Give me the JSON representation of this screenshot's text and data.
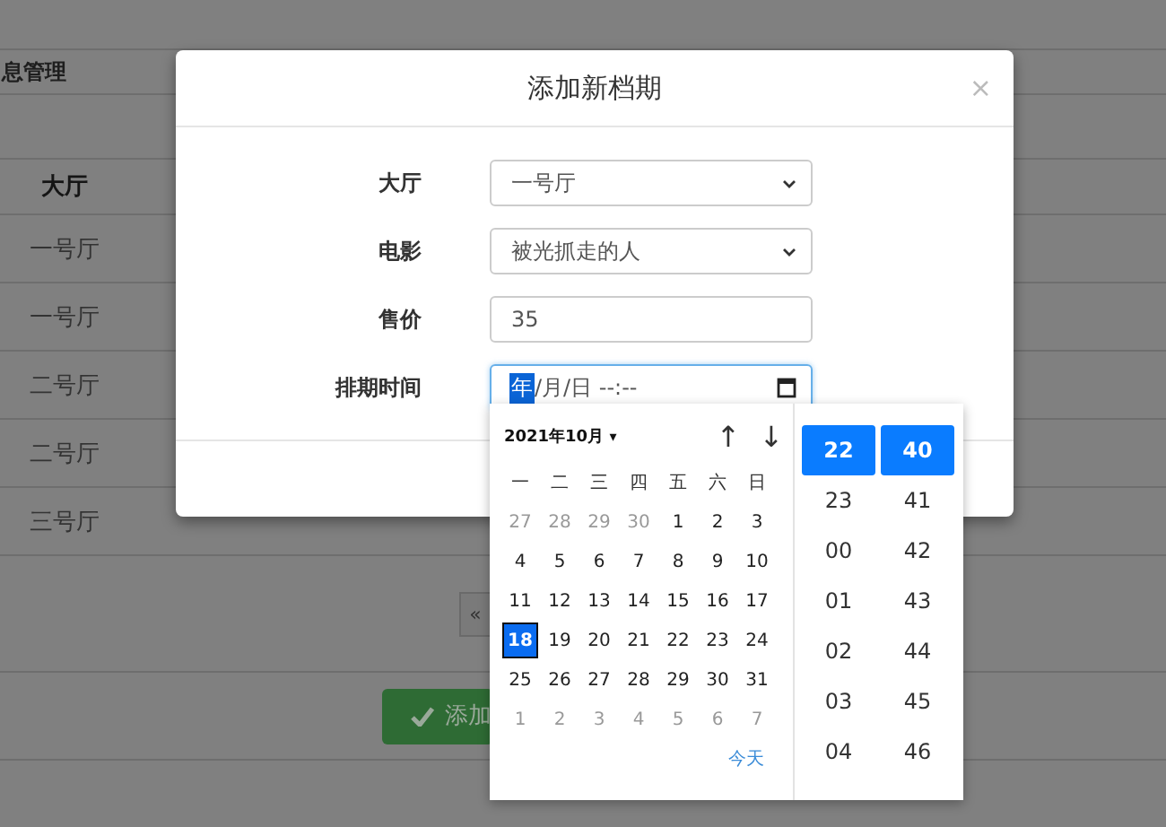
{
  "page": {
    "section_title": "息管理",
    "column_header": "大厅",
    "rows": [
      "一号厅",
      "一号厅",
      "二号厅",
      "二号厅",
      "三号厅"
    ],
    "pager": "«",
    "add_button": "添加"
  },
  "modal": {
    "title": "添加新档期",
    "close": "×",
    "fields": [
      {
        "kind": "select",
        "label": "大厅",
        "value": "一号厅"
      },
      {
        "kind": "select",
        "label": "电影",
        "value": "被光抓走的人"
      },
      {
        "kind": "input",
        "label": "售价",
        "value": "35"
      },
      {
        "kind": "datetime",
        "label": "排期时间",
        "value_parts": [
          "年",
          "/月/日 --:--"
        ]
      }
    ]
  },
  "picker": {
    "month": "2021年10月",
    "caret": "▾",
    "up": "↑",
    "down": "↓",
    "weekdays": [
      "一",
      "二",
      "三",
      "四",
      "五",
      "六",
      "日"
    ],
    "weeks": [
      [
        {
          "d": "27",
          "muted": true,
          "selected": false
        },
        {
          "d": "28",
          "muted": true,
          "selected": false
        },
        {
          "d": "29",
          "muted": true,
          "selected": false
        },
        {
          "d": "30",
          "muted": true,
          "selected": false
        },
        {
          "d": "1",
          "muted": false,
          "selected": false
        },
        {
          "d": "2",
          "muted": false,
          "selected": false
        },
        {
          "d": "3",
          "muted": false,
          "selected": false
        }
      ],
      [
        {
          "d": "4",
          "muted": false,
          "selected": false
        },
        {
          "d": "5",
          "muted": false,
          "selected": false
        },
        {
          "d": "6",
          "muted": false,
          "selected": false
        },
        {
          "d": "7",
          "muted": false,
          "selected": false
        },
        {
          "d": "8",
          "muted": false,
          "selected": false
        },
        {
          "d": "9",
          "muted": false,
          "selected": false
        },
        {
          "d": "10",
          "muted": false,
          "selected": false
        }
      ],
      [
        {
          "d": "11",
          "muted": false,
          "selected": false
        },
        {
          "d": "12",
          "muted": false,
          "selected": false
        },
        {
          "d": "13",
          "muted": false,
          "selected": false
        },
        {
          "d": "14",
          "muted": false,
          "selected": false
        },
        {
          "d": "15",
          "muted": false,
          "selected": false
        },
        {
          "d": "16",
          "muted": false,
          "selected": false
        },
        {
          "d": "17",
          "muted": false,
          "selected": false
        }
      ],
      [
        {
          "d": "18",
          "muted": false,
          "selected": true
        },
        {
          "d": "19",
          "muted": false,
          "selected": false
        },
        {
          "d": "20",
          "muted": false,
          "selected": false
        },
        {
          "d": "21",
          "muted": false,
          "selected": false
        },
        {
          "d": "22",
          "muted": false,
          "selected": false
        },
        {
          "d": "23",
          "muted": false,
          "selected": false
        },
        {
          "d": "24",
          "muted": false,
          "selected": false
        }
      ],
      [
        {
          "d": "25",
          "muted": false,
          "selected": false
        },
        {
          "d": "26",
          "muted": false,
          "selected": false
        },
        {
          "d": "27",
          "muted": false,
          "selected": false
        },
        {
          "d": "28",
          "muted": false,
          "selected": false
        },
        {
          "d": "29",
          "muted": false,
          "selected": false
        },
        {
          "d": "30",
          "muted": false,
          "selected": false
        },
        {
          "d": "31",
          "muted": false,
          "selected": false
        }
      ],
      [
        {
          "d": "1",
          "muted": true,
          "selected": false
        },
        {
          "d": "2",
          "muted": true,
          "selected": false
        },
        {
          "d": "3",
          "muted": true,
          "selected": false
        },
        {
          "d": "4",
          "muted": true,
          "selected": false
        },
        {
          "d": "5",
          "muted": true,
          "selected": false
        },
        {
          "d": "6",
          "muted": true,
          "selected": false
        },
        {
          "d": "7",
          "muted": true,
          "selected": false
        }
      ]
    ],
    "today": "今天",
    "hours": [
      {
        "v": "22",
        "selected": true
      },
      {
        "v": "23",
        "selected": false
      },
      {
        "v": "00",
        "selected": false
      },
      {
        "v": "01",
        "selected": false
      },
      {
        "v": "02",
        "selected": false
      },
      {
        "v": "03",
        "selected": false
      },
      {
        "v": "04",
        "selected": false
      }
    ],
    "minutes": [
      {
        "v": "40",
        "selected": true
      },
      {
        "v": "41",
        "selected": false
      },
      {
        "v": "42",
        "selected": false
      },
      {
        "v": "43",
        "selected": false
      },
      {
        "v": "44",
        "selected": false
      },
      {
        "v": "45",
        "selected": false
      },
      {
        "v": "46",
        "selected": false
      }
    ]
  }
}
